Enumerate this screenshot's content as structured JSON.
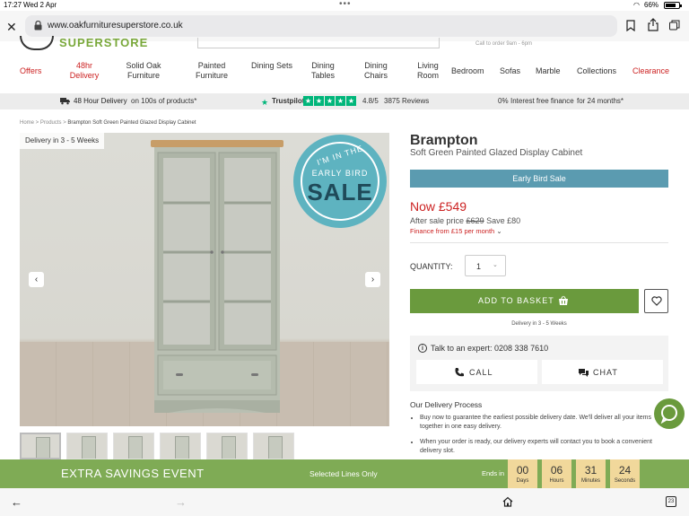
{
  "status_bar": {
    "time": "17:27",
    "date": "Wed 2 Apr",
    "battery": "66%",
    "battery_level": 0.66
  },
  "browser": {
    "url": "www.oakfurnituresuperstore.co.uk",
    "tab_count": "23"
  },
  "header": {
    "logo_text": "SUPERSTORE",
    "call_text": "Call to order 9am - 6pm",
    "nav": [
      {
        "label": "Offers",
        "accent": true
      },
      {
        "label": "48hr Delivery",
        "accent": true
      },
      {
        "label": "Solid Oak Furniture",
        "accent": false
      },
      {
        "label": "Painted Furniture",
        "accent": false
      },
      {
        "label": "Dining Sets",
        "accent": false
      },
      {
        "label": "Dining Tables",
        "accent": false
      },
      {
        "label": "Dining Chairs",
        "accent": false
      },
      {
        "label": "Living Room",
        "accent": false
      },
      {
        "label": "Bedroom",
        "accent": false
      },
      {
        "label": "Sofas",
        "accent": false
      },
      {
        "label": "Marble",
        "accent": false
      },
      {
        "label": "Collections",
        "accent": false
      },
      {
        "label": "Clearance",
        "accent": true
      }
    ]
  },
  "usp": {
    "delivery_bold": "48 Hour Delivery",
    "delivery_rest": "on 100s of products*",
    "trustpilot": "Trustpilot",
    "rating": "4.8/5",
    "reviews": "3875 Reviews",
    "finance_pct": "0%",
    "finance_bold": "Interest free finance",
    "finance_rest": "for 24 months*"
  },
  "breadcrumb": {
    "home": "Home",
    "products": "Products",
    "current": "Brampton Soft Green Painted Glazed Display Cabinet"
  },
  "gallery": {
    "delivery_tag": "Delivery in 3 - 5 Weeks",
    "badge_top": "I'M IN THE",
    "badge_mid": "EARLY BIRD",
    "badge_main": "SALE",
    "thumb_count": 6
  },
  "product": {
    "title": "Brampton",
    "subtitle": "Soft Green Painted Glazed Display Cabinet",
    "sale_banner": "Early Bird Sale",
    "price_now": "Now £549",
    "after_sale_label": "After sale price",
    "after_sale_price": "£629",
    "save": "Save £80",
    "finance": "Finance from £15 per month",
    "qty_label": "QUANTITY:",
    "qty_value": "1",
    "add_to_basket": "ADD TO BASKET",
    "delivery_note": "Delivery in 3 - 5 Weeks",
    "expert_text": "Talk to an expert: 0208 338 7610",
    "call": "CALL",
    "chat": "CHAT",
    "delivery_heading": "Our Delivery Process",
    "delivery_points": [
      "Buy now to guarantee the earliest possible delivery date. We'll deliver all your items together in one easy delivery.",
      "When your order is ready, our delivery experts will contact you to book a convenient delivery slot."
    ]
  },
  "countdown": {
    "event": "EXTRA SAVINGS EVENT",
    "selected": "Selected Lines Only",
    "ends_in": "Ends in",
    "units": [
      {
        "value": "00",
        "label": "Days"
      },
      {
        "value": "06",
        "label": "Hours"
      },
      {
        "value": "31",
        "label": "Minutes"
      },
      {
        "value": "24",
        "label": "Seconds"
      }
    ]
  },
  "colors": {
    "brand_green": "#6a9a3d",
    "accent_red": "#cc2222",
    "sale_blue": "#5b9bb0",
    "countdown_green": "#7fab55",
    "countdown_box": "#f1d89b"
  }
}
